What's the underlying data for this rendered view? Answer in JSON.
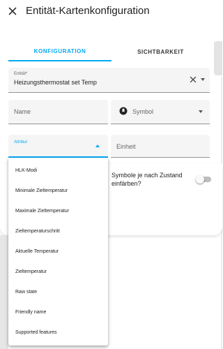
{
  "header": {
    "title": "Entität-Kartenkonfiguration"
  },
  "tabs": [
    {
      "label": "KONFIGURATION"
    },
    {
      "label": "SICHTBARKEIT"
    }
  ],
  "form": {
    "entity": {
      "label": "Entität*",
      "value": "Heizungsthermostat set Temp"
    },
    "name": {
      "placeholder": "Name"
    },
    "symbol": {
      "placeholder": "Symbol"
    },
    "attribute": {
      "label": "Attribut"
    },
    "unit": {
      "placeholder": "Einheit"
    },
    "state_color": {
      "label": "Symbole je nach Zustand einfärben?",
      "checked": false
    }
  },
  "attribute_menu": {
    "items": [
      "HLK-Modi",
      "Minimale Zieltemperatur",
      "Maximale Zieltemperatur",
      "Zieltemperaturschritt",
      "Aktuelle Temperatur",
      "Zieltemperatur",
      "Raw state",
      "Friendly name",
      "Supported features"
    ]
  },
  "colors": {
    "accent": "#03a9f4",
    "field_bg": "#f5f5f5"
  }
}
